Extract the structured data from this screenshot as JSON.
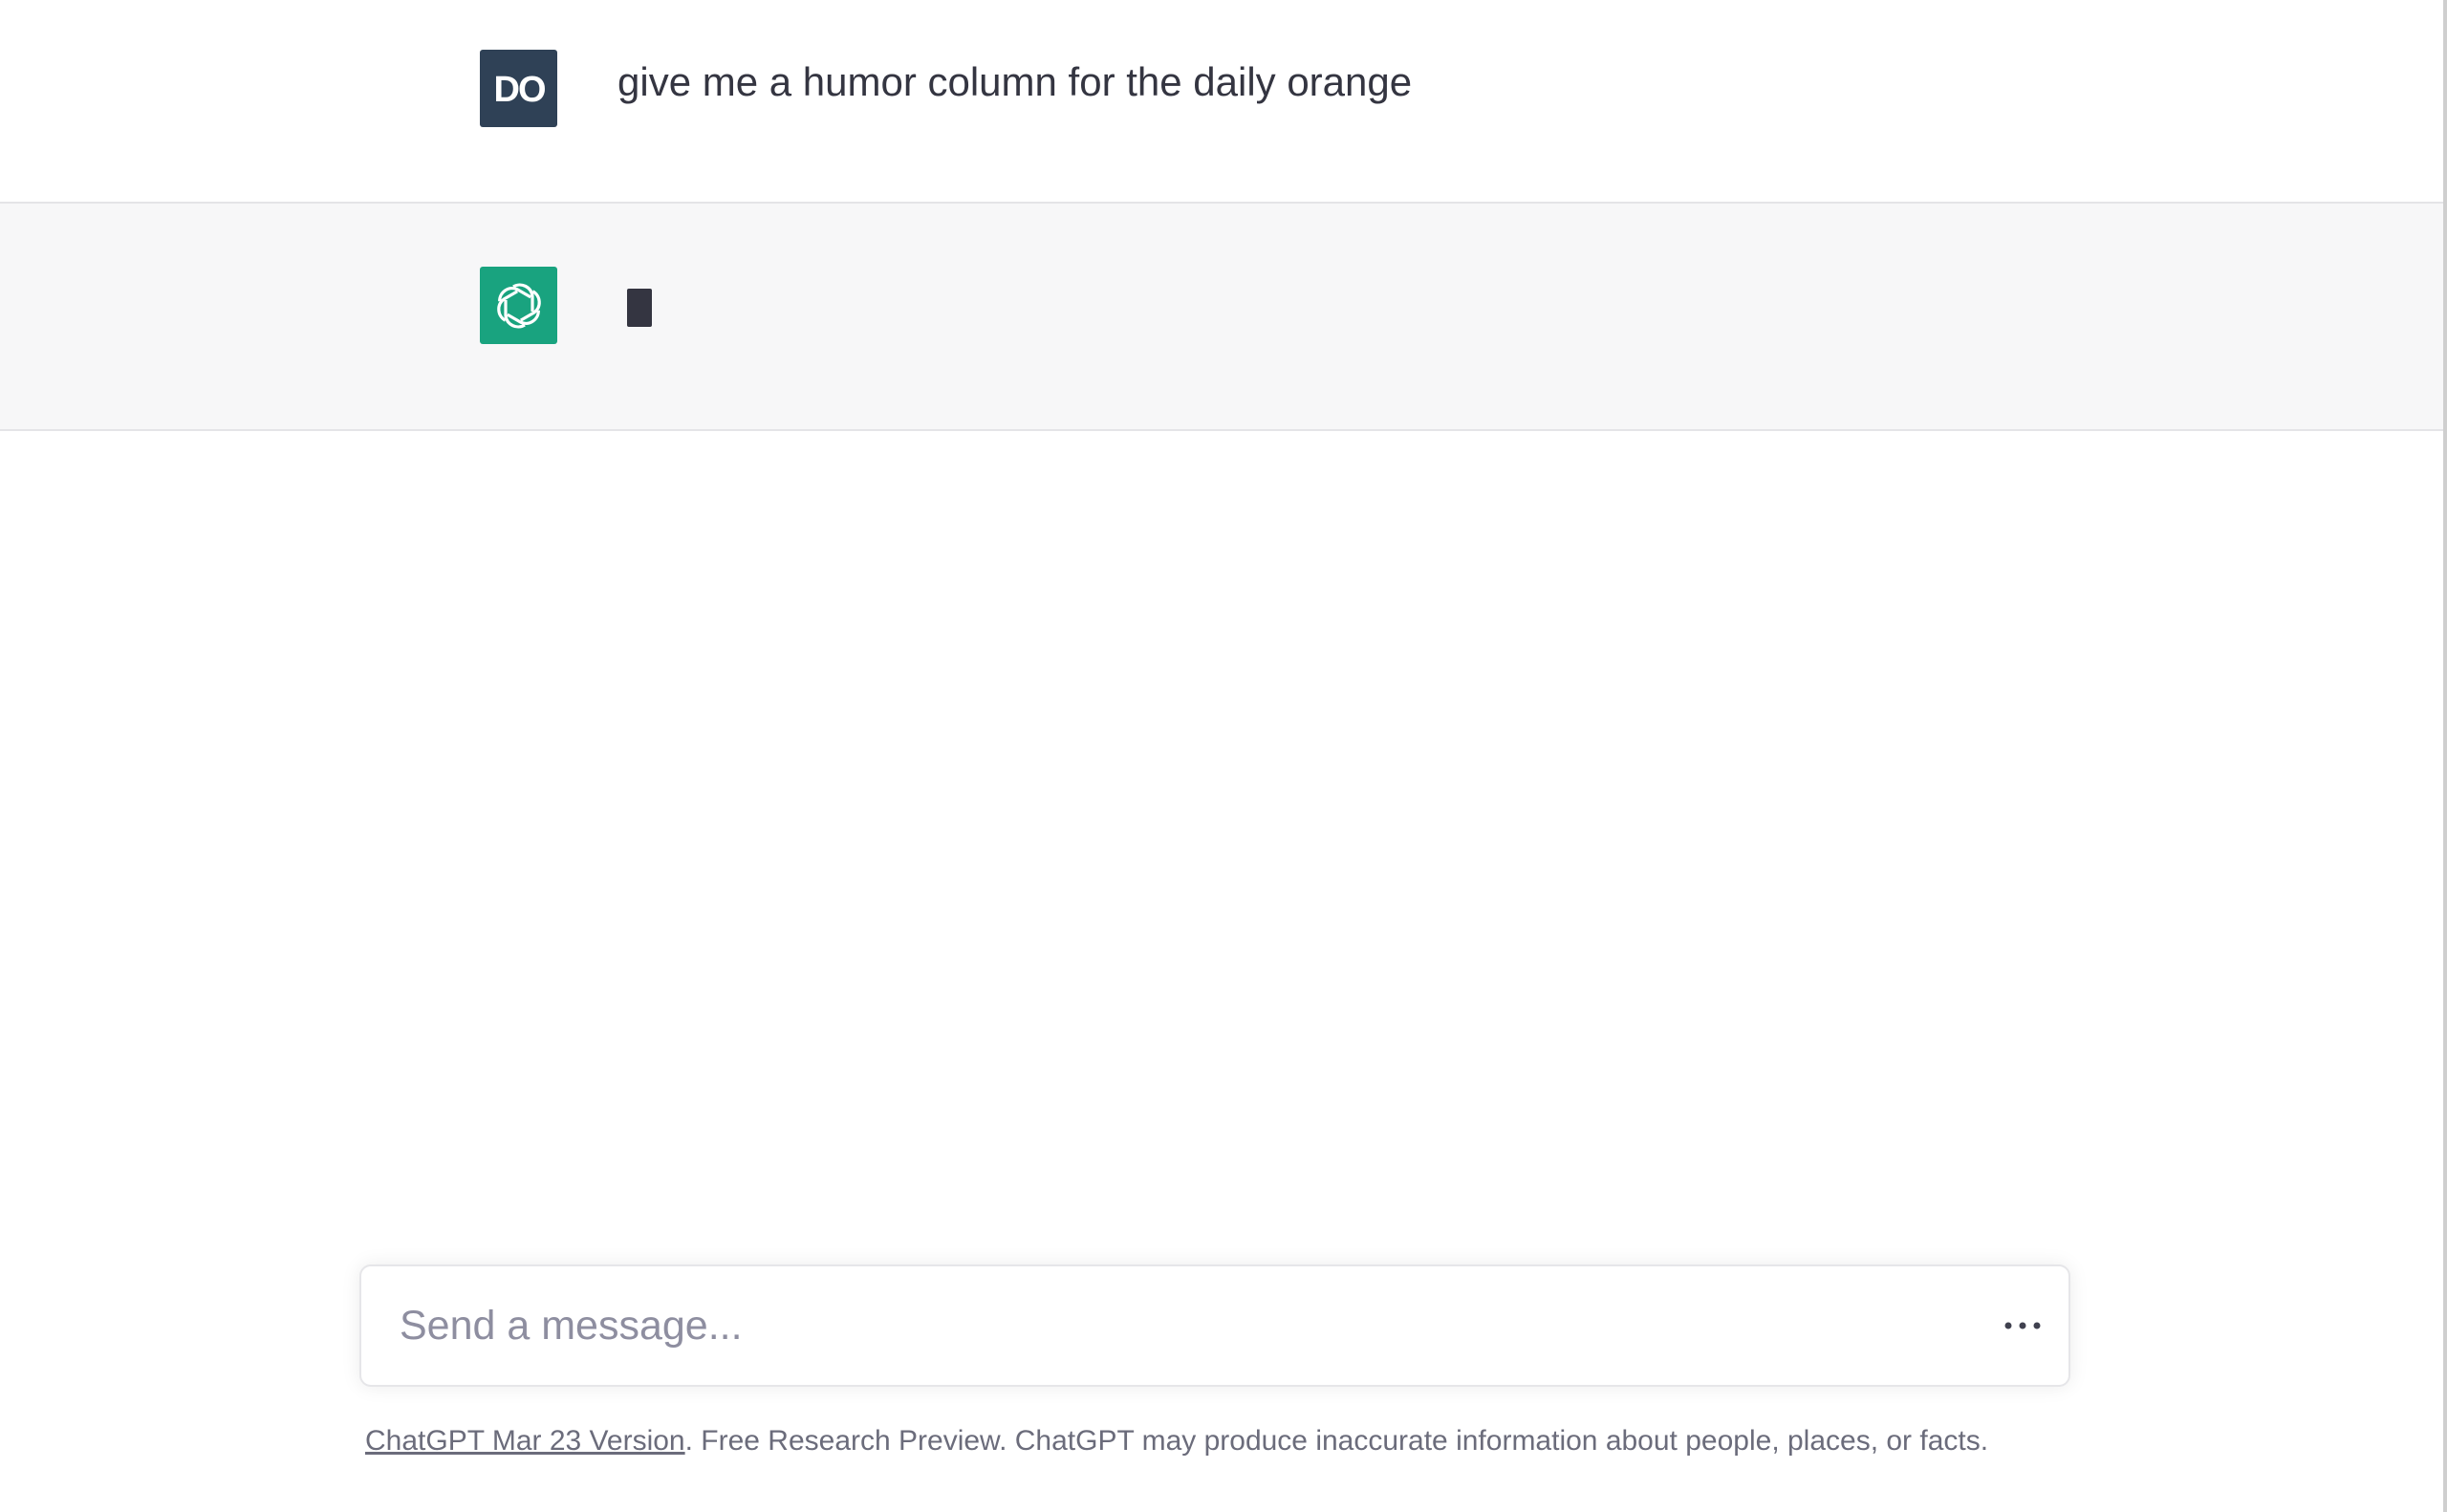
{
  "conversation": {
    "user_message": {
      "text": "give me a humor column for the daily orange",
      "avatar_initials": "DO",
      "avatar_color": "#2f4156"
    },
    "assistant_message": {
      "avatar_icon": "openai-logo-icon",
      "avatar_color": "#19a37f",
      "state": "typing"
    }
  },
  "composer": {
    "placeholder": "Send a message...",
    "value": "",
    "more_icon": "ellipsis-icon"
  },
  "footer": {
    "version_link": "ChatGPT Mar 23 Version",
    "disclaimer": ". Free Research Preview. ChatGPT may produce inaccurate information about people, places, or facts."
  }
}
